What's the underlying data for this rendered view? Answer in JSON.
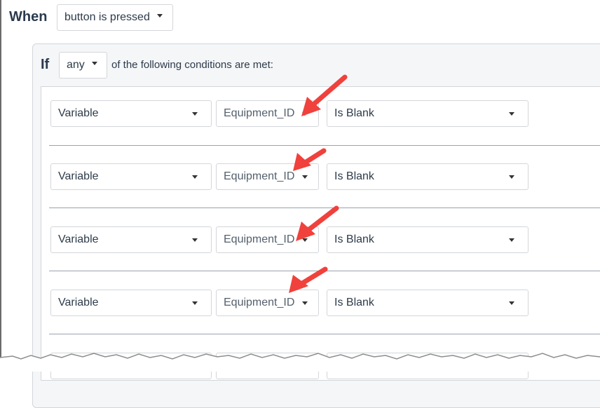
{
  "trigger": {
    "label": "When",
    "event_value": "button is pressed"
  },
  "if_block": {
    "label": "If",
    "match_value": "any",
    "suffix_text": "of the following conditions are met:"
  },
  "conditions": [
    {
      "type": "Variable",
      "variable": "Equipment_ID",
      "operator": "Is Blank"
    },
    {
      "type": "Variable",
      "variable": "Equipment_ID",
      "operator": "Is Blank"
    },
    {
      "type": "Variable",
      "variable": "Equipment_ID",
      "operator": "Is Blank"
    },
    {
      "type": "Variable",
      "variable": "Equipment_ID",
      "operator": "Is Blank"
    }
  ],
  "annotation": {
    "arrow_color": "#f0413c",
    "arrow_icon": "red-arrow-icon"
  }
}
